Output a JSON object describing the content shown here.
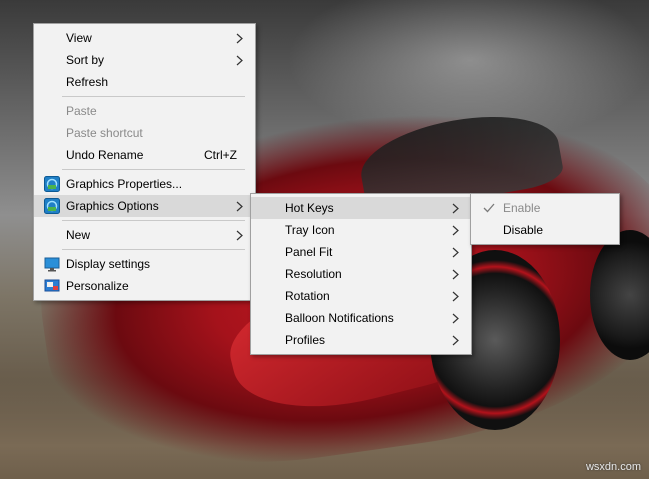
{
  "context_menu": {
    "items": [
      {
        "label": "View",
        "has_submenu": true
      },
      {
        "label": "Sort by",
        "has_submenu": true
      },
      {
        "label": "Refresh"
      },
      {
        "label": "Paste",
        "disabled": true
      },
      {
        "label": "Paste shortcut",
        "disabled": true
      },
      {
        "label": "Undo Rename",
        "shortcut": "Ctrl+Z"
      },
      {
        "label": "Graphics Properties...",
        "icon": "intel-graphics-icon"
      },
      {
        "label": "Graphics Options",
        "icon": "intel-graphics-icon",
        "has_submenu": true,
        "highlighted": true
      },
      {
        "label": "New",
        "has_submenu": true
      },
      {
        "label": "Display settings",
        "icon": "display-icon"
      },
      {
        "label": "Personalize",
        "icon": "personalize-icon"
      }
    ]
  },
  "graphics_options_menu": {
    "items": [
      {
        "label": "Hot Keys",
        "highlighted": true
      },
      {
        "label": "Tray Icon"
      },
      {
        "label": "Panel Fit"
      },
      {
        "label": "Resolution"
      },
      {
        "label": "Rotation"
      },
      {
        "label": "Balloon Notifications"
      },
      {
        "label": "Profiles"
      }
    ]
  },
  "hot_keys_menu": {
    "items": [
      {
        "label": "Enable",
        "checked": true,
        "disabled": true
      },
      {
        "label": "Disable"
      }
    ]
  },
  "watermark": "wsxdn.com",
  "colors": {
    "menu_background": "#f2f2f2",
    "highlight": "#d9d9d9",
    "disabled_text": "#8a8a8a"
  }
}
